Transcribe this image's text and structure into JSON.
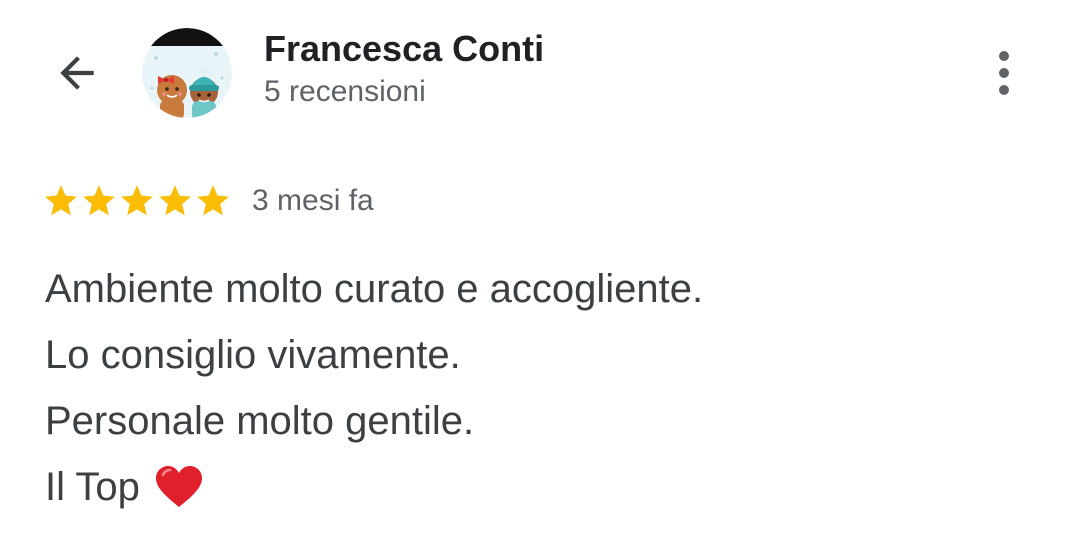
{
  "header": {
    "back_icon": "arrow-left-icon",
    "author_name": "Francesca Conti",
    "review_count": "5 recensioni",
    "avatar_icon": "gingerbread-couple-avatar",
    "more_icon": "more-vertical-icon"
  },
  "review": {
    "rating": 5,
    "rating_max": 5,
    "star_color": "#fbbc04",
    "time_ago": "3 mesi fa",
    "lines": [
      "Ambiente molto curato e accogliente.",
      "Lo consiglio vivamente.",
      "Personale molto gentile.",
      "Il Top"
    ],
    "trailing_emoji": "red-heart-icon"
  }
}
